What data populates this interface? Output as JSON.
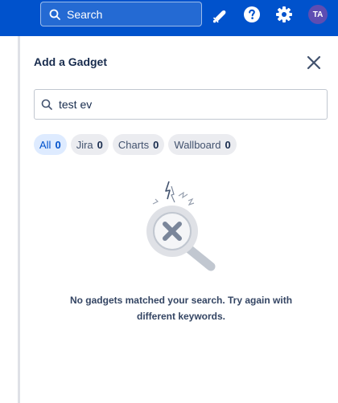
{
  "topbar": {
    "search_placeholder": "Search",
    "icons": [
      "search-icon",
      "notifications-icon",
      "help-icon",
      "settings-icon"
    ],
    "avatar_initials": "TA",
    "brand_color": "#0052cc"
  },
  "panel": {
    "title": "Add a Gadget",
    "search_value": "test ev",
    "filters": [
      {
        "label": "All",
        "count": "0",
        "active": true
      },
      {
        "label": "Jira",
        "count": "0",
        "active": false
      },
      {
        "label": "Charts",
        "count": "0",
        "active": false
      },
      {
        "label": "Wallboard",
        "count": "0",
        "active": false
      }
    ],
    "empty_message": "No gadgets matched your search. Try again with different keywords."
  }
}
